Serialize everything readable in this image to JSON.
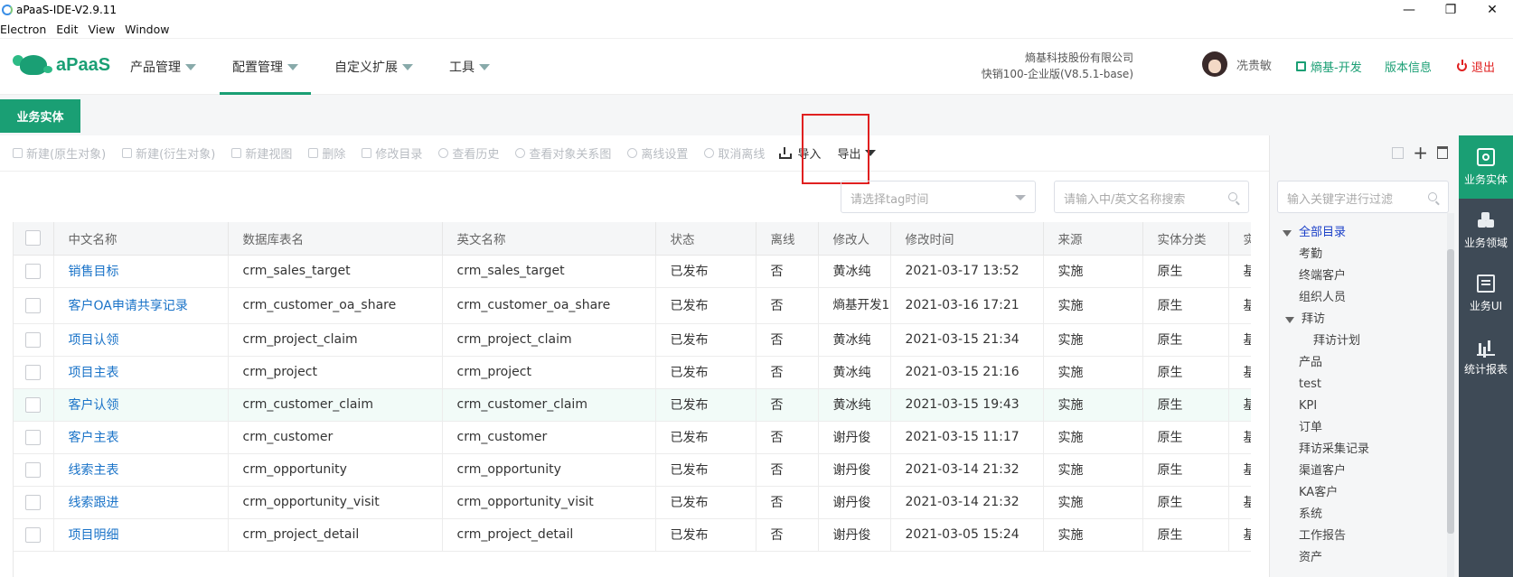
{
  "window": {
    "title": "aPaaS-IDE-V2.9.11",
    "controls": [
      "—",
      "❐",
      "✕"
    ]
  },
  "menubar": [
    "Electron",
    "Edit",
    "View",
    "Window"
  ],
  "header": {
    "brand": "aPaaS",
    "nav": [
      {
        "label": "产品管理",
        "active": false
      },
      {
        "label": "配置管理",
        "active": true
      },
      {
        "label": "自定义扩展",
        "active": false
      },
      {
        "label": "工具",
        "active": false
      }
    ],
    "company_name": "熵基科技股份有限公司",
    "company_edition": "快销100-企业版(V8.5.1-base)",
    "user_name": "冼贵敏",
    "env_label": "熵基-开发",
    "version_label": "版本信息",
    "logout_label": "退出"
  },
  "tab": {
    "label": "业务实体"
  },
  "toolbar": {
    "items": [
      {
        "label": "新建(原生对象)",
        "enabled": false
      },
      {
        "label": "新建(衍生对象)",
        "enabled": false
      },
      {
        "label": "新建视图",
        "enabled": false
      },
      {
        "label": "删除",
        "enabled": false
      },
      {
        "label": "修改目录",
        "enabled": false
      },
      {
        "label": "查看历史",
        "enabled": false
      },
      {
        "label": "查看对象关系图",
        "enabled": false
      },
      {
        "label": "离线设置",
        "enabled": false
      },
      {
        "label": "取消离线",
        "enabled": false
      }
    ],
    "import_label": "导入",
    "export_label": "导出"
  },
  "filters": {
    "tag_placeholder": "请选择tag时间",
    "search_placeholder": "请输入中/英文名称搜索"
  },
  "table": {
    "columns": [
      "中文名称",
      "数据库表名",
      "英文名称",
      "状态",
      "离线",
      "修改人",
      "修改时间",
      "来源",
      "实体分类",
      "实"
    ],
    "rows": [
      {
        "cn": "销售目标",
        "db": "crm_sales_target",
        "en": "crm_sales_target",
        "status": "已发布",
        "offline": "否",
        "modifier": "黄冰纯",
        "time": "2021-03-17 13:52",
        "source": "实施",
        "category": "原生",
        "extra": "基"
      },
      {
        "cn": "客户OA申请共享记录",
        "db": "crm_customer_oa_share",
        "en": "crm_customer_oa_share",
        "status": "已发布",
        "offline": "否",
        "modifier": "熵基开发1",
        "time": "2021-03-16 17:21",
        "source": "实施",
        "category": "原生",
        "extra": "基"
      },
      {
        "cn": "项目认领",
        "db": "crm_project_claim",
        "en": "crm_project_claim",
        "status": "已发布",
        "offline": "否",
        "modifier": "黄冰纯",
        "time": "2021-03-15 21:34",
        "source": "实施",
        "category": "原生",
        "extra": "基"
      },
      {
        "cn": "项目主表",
        "db": "crm_project",
        "en": "crm_project",
        "status": "已发布",
        "offline": "否",
        "modifier": "黄冰纯",
        "time": "2021-03-15 21:16",
        "source": "实施",
        "category": "原生",
        "extra": "基"
      },
      {
        "cn": "客户认领",
        "db": "crm_customer_claim",
        "en": "crm_customer_claim",
        "status": "已发布",
        "offline": "否",
        "modifier": "黄冰纯",
        "time": "2021-03-15 19:43",
        "source": "实施",
        "category": "原生",
        "extra": "基"
      },
      {
        "cn": "客户主表",
        "db": "crm_customer",
        "en": "crm_customer",
        "status": "已发布",
        "offline": "否",
        "modifier": "谢丹俊",
        "time": "2021-03-15 11:17",
        "source": "实施",
        "category": "原生",
        "extra": "基"
      },
      {
        "cn": "线索主表",
        "db": "crm_opportunity",
        "en": "crm_opportunity",
        "status": "已发布",
        "offline": "否",
        "modifier": "谢丹俊",
        "time": "2021-03-14 21:32",
        "source": "实施",
        "category": "原生",
        "extra": "基"
      },
      {
        "cn": "线索跟进",
        "db": "crm_opportunity_visit",
        "en": "crm_opportunity_visit",
        "status": "已发布",
        "offline": "否",
        "modifier": "谢丹俊",
        "time": "2021-03-14 21:32",
        "source": "实施",
        "category": "原生",
        "extra": "基"
      },
      {
        "cn": "项目明细",
        "db": "crm_project_detail",
        "en": "crm_project_detail",
        "status": "已发布",
        "offline": "否",
        "modifier": "谢丹俊",
        "time": "2021-03-05 15:24",
        "source": "实施",
        "category": "原生",
        "extra": "基"
      }
    ]
  },
  "tree": {
    "filter_placeholder": "输入关键字进行过滤",
    "root": "全部目录",
    "children": [
      "考勤",
      "终端客户",
      "组织人员"
    ],
    "visit": "拜访",
    "visit_child": "拜访计划",
    "rest": [
      "产品",
      "test",
      "KPI",
      "订单",
      "拜访采集记录",
      "渠道客户",
      "KA客户",
      "系统",
      "工作报告",
      "资产"
    ]
  },
  "vnav": [
    {
      "label": "业务实体",
      "icon": "gear-box-icon",
      "active": true
    },
    {
      "label": "业务领域",
      "icon": "cubes-icon",
      "active": false
    },
    {
      "label": "业务UI",
      "icon": "ui-icon",
      "active": false
    },
    {
      "label": "统计报表",
      "icon": "bar-chart-icon",
      "active": false
    }
  ],
  "colors": {
    "brand": "#1a9f74",
    "link": "#1a73c8",
    "danger": "#e02020",
    "sidebar": "#3e4a56"
  }
}
